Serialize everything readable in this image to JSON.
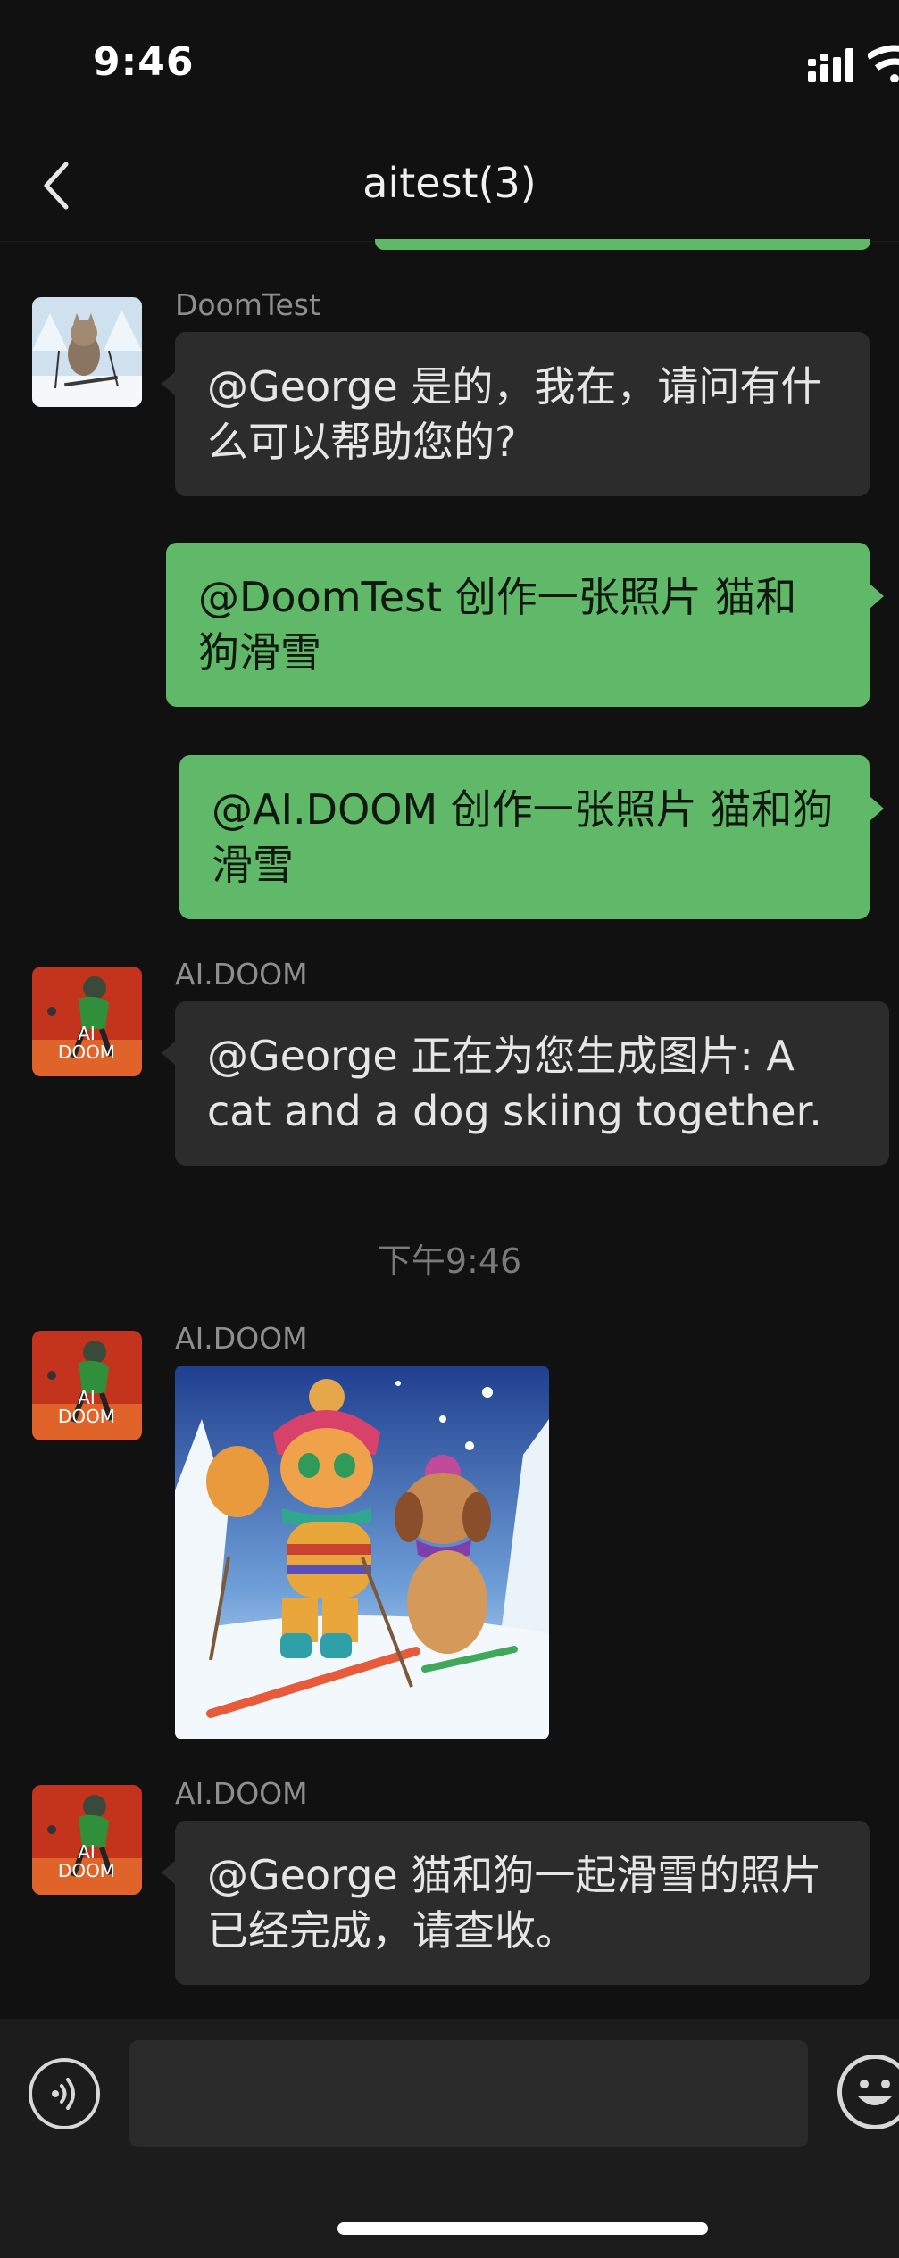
{
  "status_bar": {
    "time": "9:46"
  },
  "header": {
    "title": "aitest(3)"
  },
  "messages": [
    {
      "sender": "DoomTest",
      "direction": "in",
      "text": "@George 是的，我在，请问有什么可以帮助您的?"
    },
    {
      "direction": "out",
      "text": "@DoomTest 创作一张照片 猫和狗滑雪"
    },
    {
      "direction": "out",
      "text": "@AI.DOOM 创作一张照片 猫和狗滑雪"
    },
    {
      "sender": "AI.DOOM",
      "direction": "in",
      "text": "@George 正在为您生成图片: A cat and a dog skiing together."
    },
    {
      "sender": "AI.DOOM",
      "direction": "in",
      "type": "image"
    },
    {
      "sender": "AI.DOOM",
      "direction": "in",
      "text": "@George 猫和狗一起滑雪的照片已经完成，请查收。"
    }
  ],
  "timestamp": "下午9:46",
  "avatar_labels": {
    "ai_doom": "AI DOOM"
  },
  "colors": {
    "outgoing_bubble": "#5fb968",
    "incoming_bubble": "#2c2c2c",
    "background": "#111111"
  },
  "icons": {
    "back": "chevron-left-icon",
    "voice": "voice-icon",
    "emoji": "emoji-icon",
    "signal": "signal-icon",
    "wifi": "wifi-icon"
  }
}
